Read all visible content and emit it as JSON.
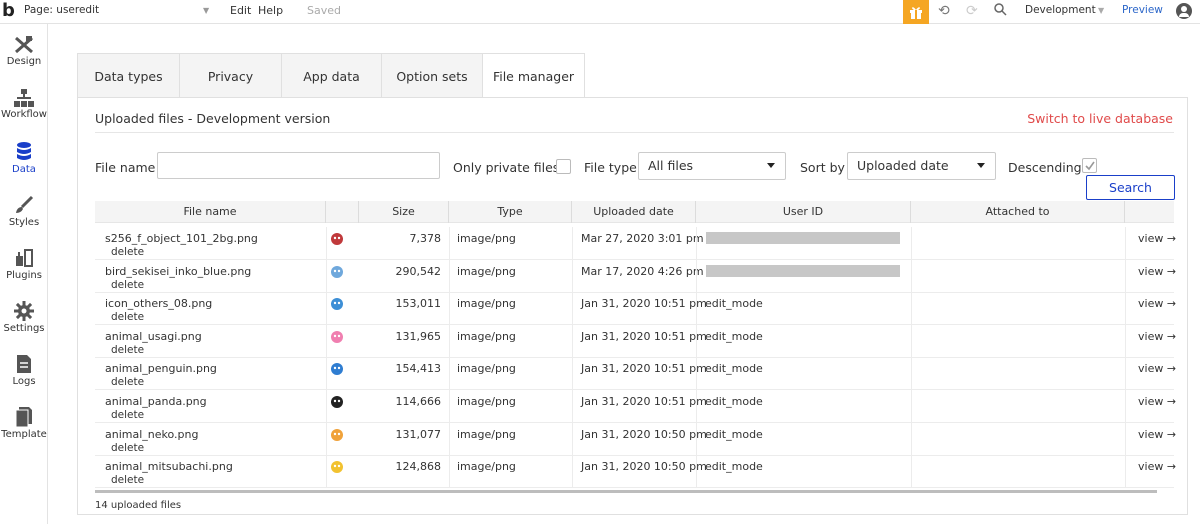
{
  "topbar": {
    "logo": "b",
    "page_label": "Page: useredit",
    "menu": [
      "Edit",
      "Help",
      "Saved"
    ],
    "environment": "Development",
    "preview": "Preview"
  },
  "sidebar": {
    "items": [
      {
        "label": "Design",
        "icon": "design-icon"
      },
      {
        "label": "Workflow",
        "icon": "workflow-icon"
      },
      {
        "label": "Data",
        "icon": "database-icon",
        "active": true
      },
      {
        "label": "Styles",
        "icon": "brush-icon"
      },
      {
        "label": "Plugins",
        "icon": "plug-icon"
      },
      {
        "label": "Settings",
        "icon": "gear-icon"
      },
      {
        "label": "Logs",
        "icon": "document-icon"
      },
      {
        "label": "Template",
        "icon": "template-icon"
      }
    ]
  },
  "tabs": [
    {
      "label": "Data types"
    },
    {
      "label": "Privacy"
    },
    {
      "label": "App data"
    },
    {
      "label": "Option sets"
    },
    {
      "label": "File manager",
      "active": true
    }
  ],
  "panel": {
    "title": "Uploaded files - Development version",
    "switch_link": "Switch to live database"
  },
  "filters": {
    "file_name_label": "File name",
    "file_name_value": "",
    "private_label": "Only private files",
    "private_checked": false,
    "file_type_label": "File type",
    "file_type_value": "All files",
    "sort_label": "Sort by",
    "sort_value": "Uploaded date",
    "descending_label": "Descending",
    "descending_checked": true,
    "search_label": "Search"
  },
  "table": {
    "headers": [
      "File name",
      "",
      "Size",
      "Type",
      "Uploaded date",
      "User ID",
      "Attached to"
    ],
    "delete_label": "delete",
    "view_label": "view →",
    "rows": [
      {
        "name": "s256_f_object_101_2bg.png",
        "size": "7,378",
        "type": "image/png",
        "date": "Mar 27, 2020 3:01 pm",
        "user": "",
        "redacted": true,
        "thumb": "bow-thumb",
        "color": "#c0393b"
      },
      {
        "name": "bird_sekisei_inko_blue.png",
        "size": "290,542",
        "type": "image/png",
        "date": "Mar 17, 2020 4:26 pm",
        "user": "",
        "redacted": true,
        "thumb": "bird-thumb",
        "color": "#6fa8dc"
      },
      {
        "name": "icon_others_08.png",
        "size": "153,011",
        "type": "image/png",
        "date": "Jan 31, 2020 10:51 pm",
        "user": "edit_mode",
        "redacted": false,
        "thumb": "elephant-thumb",
        "color": "#3d8fd6"
      },
      {
        "name": "animal_usagi.png",
        "size": "131,965",
        "type": "image/png",
        "date": "Jan 31, 2020 10:51 pm",
        "user": "edit_mode",
        "redacted": false,
        "thumb": "rabbit-thumb",
        "color": "#f07fb0"
      },
      {
        "name": "animal_penguin.png",
        "size": "154,413",
        "type": "image/png",
        "date": "Jan 31, 2020 10:51 pm",
        "user": "edit_mode",
        "redacted": false,
        "thumb": "penguin-thumb",
        "color": "#2f7dd1"
      },
      {
        "name": "animal_panda.png",
        "size": "114,666",
        "type": "image/png",
        "date": "Jan 31, 2020 10:51 pm",
        "user": "edit_mode",
        "redacted": false,
        "thumb": "panda-thumb",
        "color": "#222222"
      },
      {
        "name": "animal_neko.png",
        "size": "131,077",
        "type": "image/png",
        "date": "Jan 31, 2020 10:50 pm",
        "user": "edit_mode",
        "redacted": false,
        "thumb": "cat-thumb",
        "color": "#f0a23a"
      },
      {
        "name": "animal_mitsubachi.png",
        "size": "124,868",
        "type": "image/png",
        "date": "Jan 31, 2020 10:50 pm",
        "user": "edit_mode",
        "redacted": false,
        "thumb": "bee-thumb",
        "color": "#f2c230"
      }
    ]
  },
  "footer": {
    "count": "14 uploaded files"
  }
}
